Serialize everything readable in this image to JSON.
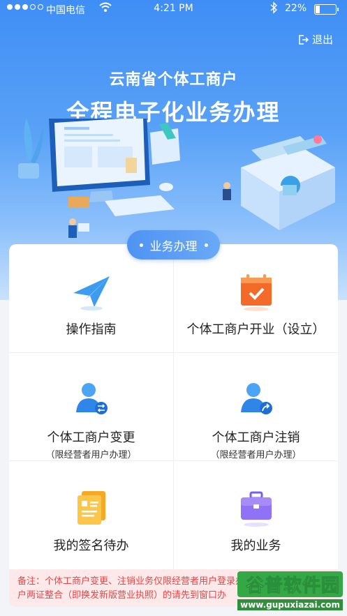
{
  "status_bar": {
    "carrier": "中国电信",
    "time": "4:21 PM",
    "battery": "22%"
  },
  "header": {
    "logout_label": "退出",
    "title_line1": "云南省个体工商户",
    "title_line2": "全程电子化业务办理"
  },
  "section": {
    "label": "业务办理"
  },
  "services": [
    {
      "label": "操作指南",
      "sub": "",
      "icon": "paper-plane-icon"
    },
    {
      "label": "个体工商户开业（设立）",
      "sub": "",
      "icon": "calendar-check-icon"
    },
    {
      "label": "个体工商户变更",
      "sub": "（限经营者用户办理）",
      "icon": "user-change-icon"
    },
    {
      "label": "个体工商户注销",
      "sub": "（限经营者用户办理）",
      "icon": "user-cancel-icon"
    },
    {
      "label": "我的签名待办",
      "sub": "",
      "icon": "sign-document-icon"
    },
    {
      "label": "我的业务",
      "sub": "",
      "icon": "briefcase-icon"
    }
  ],
  "note": {
    "text": "备注：个体工商户变更、注销业务仅限经营者用户登录办理，未办理个体工商户两证整合（即换发新版营业执照）的请先到窗口办"
  },
  "watermark": {
    "brand": "谷普软件园",
    "url": "www.gupuxiazai.com"
  }
}
